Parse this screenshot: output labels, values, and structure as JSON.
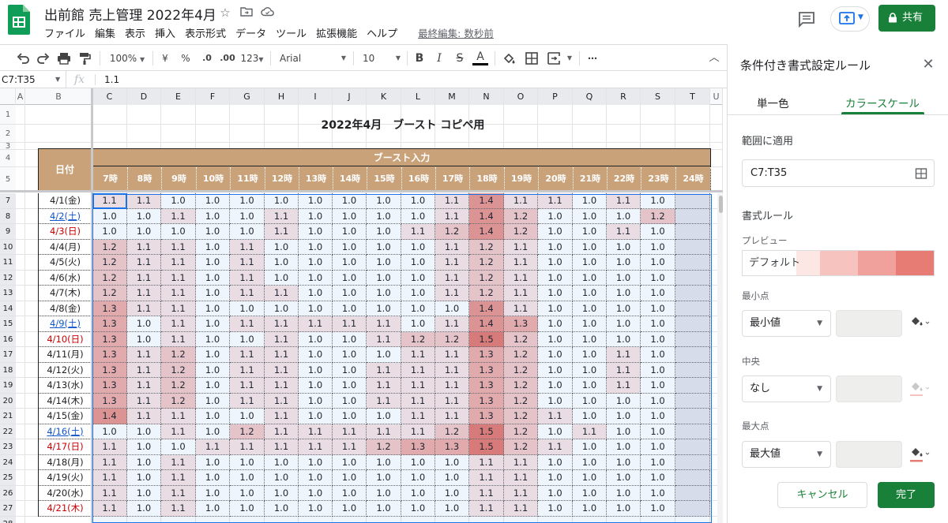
{
  "header": {
    "title": "出前館 売上管理 2022年4月",
    "menu": [
      "ファイル",
      "編集",
      "表示",
      "挿入",
      "表示形式",
      "データ",
      "ツール",
      "拡張機能",
      "ヘルプ"
    ],
    "last_edit": "最終編集: 数秒前",
    "share_label": "共有"
  },
  "toolbar": {
    "zoom": "100%",
    "currency": "¥",
    "percent": "%",
    "dec_decrease": ".0",
    "dec_increase": ".00",
    "more_formats": "123",
    "font": "Arial",
    "font_size": "10",
    "bold": "B",
    "italic": "I",
    "strike": "S",
    "text_color": "A",
    "more": "⋯"
  },
  "formula_bar": {
    "name_box": "C7:T35",
    "fx": "fx",
    "value": "1.1"
  },
  "sheet": {
    "columns": [
      "A",
      "B",
      "C",
      "D",
      "E",
      "F",
      "G",
      "H",
      "I",
      "J",
      "K",
      "L",
      "M",
      "N",
      "O",
      "P",
      "Q",
      "R",
      "S",
      "T",
      "U"
    ],
    "row_numbers": [
      "1",
      "2",
      "3",
      "4",
      "5",
      "7",
      "8",
      "9",
      "10",
      "11",
      "12",
      "13",
      "14",
      "15",
      "16",
      "17",
      "18",
      "19",
      "20",
      "21",
      "22",
      "23",
      "24",
      "25",
      "26",
      "27",
      "28"
    ],
    "title": "2022年4月　ブースト コピペ用",
    "date_header": "日付",
    "boost_header": "ブースト入力",
    "hours": [
      "7時",
      "8時",
      "9時",
      "10時",
      "11時",
      "12時",
      "13時",
      "14時",
      "15時",
      "16時",
      "17時",
      "18時",
      "19時",
      "20時",
      "21時",
      "22時",
      "23時",
      "24時"
    ],
    "rows": [
      {
        "date": "4/1(金)",
        "day": "weekday",
        "values": [
          "1.1",
          "1.1",
          "1.0",
          "1.0",
          "1.0",
          "1.0",
          "1.0",
          "1.0",
          "1.0",
          "1.0",
          "1.1",
          "1.4",
          "1.1",
          "1.1",
          "1.0",
          "1.1",
          "1.0"
        ]
      },
      {
        "date": "4/2(土)",
        "day": "sat",
        "values": [
          "1.0",
          "1.0",
          "1.1",
          "1.0",
          "1.0",
          "1.1",
          "1.0",
          "1.0",
          "1.0",
          "1.0",
          "1.1",
          "1.4",
          "1.2",
          "1.0",
          "1.0",
          "1.0",
          "1.2"
        ]
      },
      {
        "date": "4/3(日)",
        "day": "sun",
        "values": [
          "1.0",
          "1.0",
          "1.0",
          "1.0",
          "1.0",
          "1.1",
          "1.0",
          "1.0",
          "1.0",
          "1.1",
          "1.2",
          "1.4",
          "1.2",
          "1.0",
          "1.0",
          "1.1",
          "1.0"
        ]
      },
      {
        "date": "4/4(月)",
        "day": "weekday",
        "values": [
          "1.2",
          "1.1",
          "1.1",
          "1.0",
          "1.1",
          "1.0",
          "1.0",
          "1.0",
          "1.0",
          "1.0",
          "1.1",
          "1.2",
          "1.1",
          "1.0",
          "1.0",
          "1.0",
          "1.0"
        ]
      },
      {
        "date": "4/5(火)",
        "day": "weekday",
        "values": [
          "1.2",
          "1.1",
          "1.1",
          "1.0",
          "1.1",
          "1.0",
          "1.0",
          "1.0",
          "1.0",
          "1.0",
          "1.1",
          "1.2",
          "1.1",
          "1.0",
          "1.0",
          "1.0",
          "1.0"
        ]
      },
      {
        "date": "4/6(水)",
        "day": "weekday",
        "values": [
          "1.2",
          "1.1",
          "1.1",
          "1.0",
          "1.1",
          "1.0",
          "1.0",
          "1.0",
          "1.0",
          "1.0",
          "1.1",
          "1.2",
          "1.1",
          "1.0",
          "1.0",
          "1.0",
          "1.0"
        ]
      },
      {
        "date": "4/7(木)",
        "day": "weekday",
        "values": [
          "1.2",
          "1.1",
          "1.1",
          "1.0",
          "1.1",
          "1.1",
          "1.0",
          "1.0",
          "1.0",
          "1.0",
          "1.1",
          "1.2",
          "1.1",
          "1.0",
          "1.0",
          "1.0",
          "1.0"
        ]
      },
      {
        "date": "4/8(金)",
        "day": "weekday",
        "values": [
          "1.3",
          "1.1",
          "1.1",
          "1.0",
          "1.0",
          "1.0",
          "1.0",
          "1.0",
          "1.0",
          "1.0",
          "1.0",
          "1.4",
          "1.1",
          "1.0",
          "1.0",
          "1.0",
          "1.0"
        ]
      },
      {
        "date": "4/9(土)",
        "day": "sat",
        "values": [
          "1.3",
          "1.0",
          "1.1",
          "1.0",
          "1.1",
          "1.1",
          "1.1",
          "1.1",
          "1.1",
          "1.0",
          "1.1",
          "1.4",
          "1.3",
          "1.0",
          "1.0",
          "1.0",
          "1.0"
        ]
      },
      {
        "date": "4/10(日)",
        "day": "sun",
        "values": [
          "1.3",
          "1.0",
          "1.1",
          "1.0",
          "1.0",
          "1.1",
          "1.0",
          "1.0",
          "1.1",
          "1.2",
          "1.2",
          "1.5",
          "1.2",
          "1.0",
          "1.0",
          "1.0",
          "1.0"
        ]
      },
      {
        "date": "4/11(月)",
        "day": "weekday",
        "values": [
          "1.3",
          "1.1",
          "1.2",
          "1.0",
          "1.1",
          "1.1",
          "1.0",
          "1.0",
          "1.0",
          "1.1",
          "1.1",
          "1.3",
          "1.2",
          "1.0",
          "1.0",
          "1.1",
          "1.0"
        ]
      },
      {
        "date": "4/12(火)",
        "day": "weekday",
        "values": [
          "1.3",
          "1.1",
          "1.2",
          "1.0",
          "1.1",
          "1.1",
          "1.0",
          "1.0",
          "1.1",
          "1.1",
          "1.1",
          "1.3",
          "1.2",
          "1.0",
          "1.0",
          "1.1",
          "1.0"
        ]
      },
      {
        "date": "4/13(水)",
        "day": "weekday",
        "values": [
          "1.3",
          "1.1",
          "1.2",
          "1.0",
          "1.1",
          "1.1",
          "1.0",
          "1.0",
          "1.1",
          "1.1",
          "1.1",
          "1.3",
          "1.2",
          "1.0",
          "1.0",
          "1.1",
          "1.0"
        ]
      },
      {
        "date": "4/14(木)",
        "day": "weekday",
        "values": [
          "1.3",
          "1.1",
          "1.2",
          "1.0",
          "1.1",
          "1.1",
          "1.0",
          "1.0",
          "1.1",
          "1.1",
          "1.1",
          "1.3",
          "1.2",
          "1.0",
          "1.0",
          "1.0",
          "1.0"
        ]
      },
      {
        "date": "4/15(金)",
        "day": "weekday",
        "values": [
          "1.4",
          "1.1",
          "1.1",
          "1.0",
          "1.0",
          "1.1",
          "1.0",
          "1.0",
          "1.0",
          "1.1",
          "1.1",
          "1.3",
          "1.2",
          "1.1",
          "1.0",
          "1.0",
          "1.0"
        ]
      },
      {
        "date": "4/16(土)",
        "day": "sat",
        "values": [
          "1.0",
          "1.0",
          "1.1",
          "1.0",
          "1.2",
          "1.1",
          "1.1",
          "1.1",
          "1.1",
          "1.1",
          "1.2",
          "1.5",
          "1.2",
          "1.0",
          "1.1",
          "1.0",
          "1.0"
        ]
      },
      {
        "date": "4/17(日)",
        "day": "sun",
        "values": [
          "1.1",
          "1.0",
          "1.0",
          "1.1",
          "1.1",
          "1.1",
          "1.1",
          "1.1",
          "1.2",
          "1.3",
          "1.3",
          "1.5",
          "1.2",
          "1.1",
          "1.0",
          "1.0",
          "1.0"
        ]
      },
      {
        "date": "4/18(月)",
        "day": "weekday",
        "values": [
          "1.1",
          "1.0",
          "1.1",
          "1.0",
          "1.0",
          "1.0",
          "1.0",
          "1.0",
          "1.0",
          "1.0",
          "1.0",
          "1.1",
          "1.1",
          "1.0",
          "1.0",
          "1.0",
          "1.0"
        ]
      },
      {
        "date": "4/19(火)",
        "day": "weekday",
        "values": [
          "1.1",
          "1.0",
          "1.1",
          "1.0",
          "1.0",
          "1.0",
          "1.0",
          "1.0",
          "1.0",
          "1.0",
          "1.0",
          "1.1",
          "1.1",
          "1.0",
          "1.0",
          "1.0",
          "1.0"
        ]
      },
      {
        "date": "4/20(水)",
        "day": "weekday",
        "values": [
          "1.1",
          "1.0",
          "1.1",
          "1.0",
          "1.0",
          "1.0",
          "1.0",
          "1.0",
          "1.0",
          "1.0",
          "1.0",
          "1.1",
          "1.1",
          "1.0",
          "1.0",
          "1.0",
          "1.0"
        ]
      },
      {
        "date": "4/21(木)",
        "day": "sun",
        "values": [
          "1.1",
          "1.0",
          "1.1",
          "1.0",
          "1.0",
          "1.0",
          "1.0",
          "1.0",
          "1.0",
          "1.0",
          "1.0",
          "1.1",
          "1.1",
          "1.0",
          "1.0",
          "1.0",
          "1.0"
        ]
      }
    ],
    "colors": {
      "header_fill": "#c9a27a",
      "min_color": "#ffffff",
      "max_color": "#e67c73",
      "sat_color": "#1155cc",
      "sun_color": "#cc0000"
    }
  },
  "panel": {
    "title": "条件付き書式設定ルール",
    "tabs": [
      "単一色",
      "カラースケール"
    ],
    "active_tab": "カラースケール",
    "range_label": "範囲に適用",
    "range_value": "C7:T35",
    "rules_label": "書式ルール",
    "preview_label": "プレビュー",
    "preview_text": "デフォルト",
    "preview_colors": [
      "#fde7e5",
      "#f6c3bf",
      "#f0a19b",
      "#e67c73"
    ],
    "min_label": "最小点",
    "min_value": "最小値",
    "mid_label": "中央",
    "mid_value": "なし",
    "max_label": "最大点",
    "max_value": "最大値",
    "cancel_label": "キャンセル",
    "done_label": "完了"
  }
}
